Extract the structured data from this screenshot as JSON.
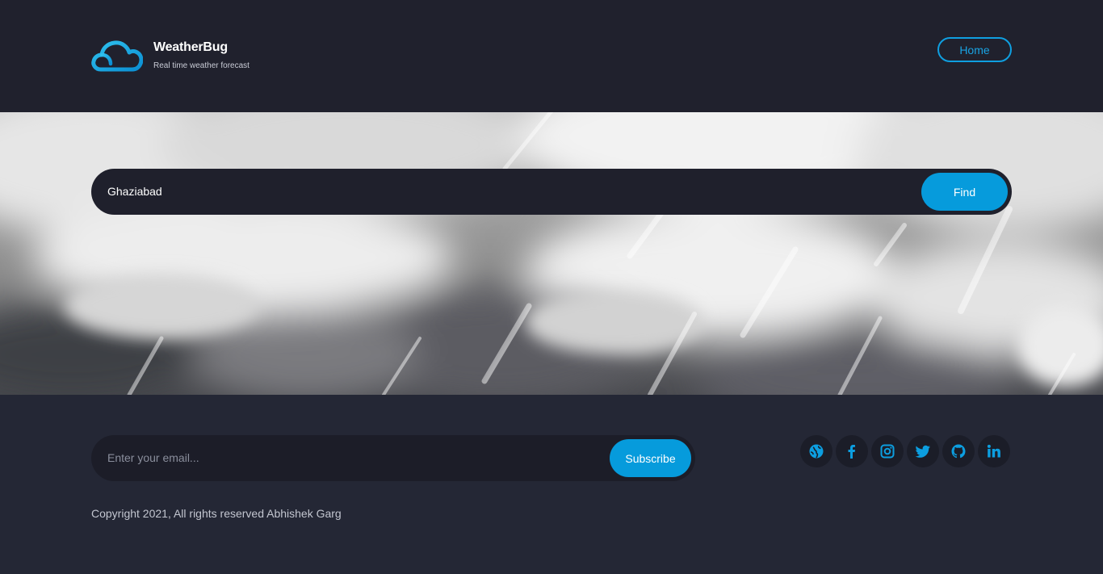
{
  "brand": {
    "title": "WeatherBug",
    "tagline": "Real time weather forecast",
    "logo_icon": "cloud-icon",
    "accent_color": "#069bdc"
  },
  "nav": {
    "home_label": "Home"
  },
  "search": {
    "value": "Ghaziabad",
    "button_label": "Find"
  },
  "subscribe": {
    "placeholder": "Enter your email...",
    "button_label": "Subscribe"
  },
  "socials": [
    {
      "icon": "globe-icon"
    },
    {
      "icon": "facebook-icon"
    },
    {
      "icon": "instagram-icon"
    },
    {
      "icon": "twitter-icon"
    },
    {
      "icon": "github-icon"
    },
    {
      "icon": "linkedin-icon"
    }
  ],
  "copyright": "Copyright 2021, All rights reserved Abhishek Garg"
}
